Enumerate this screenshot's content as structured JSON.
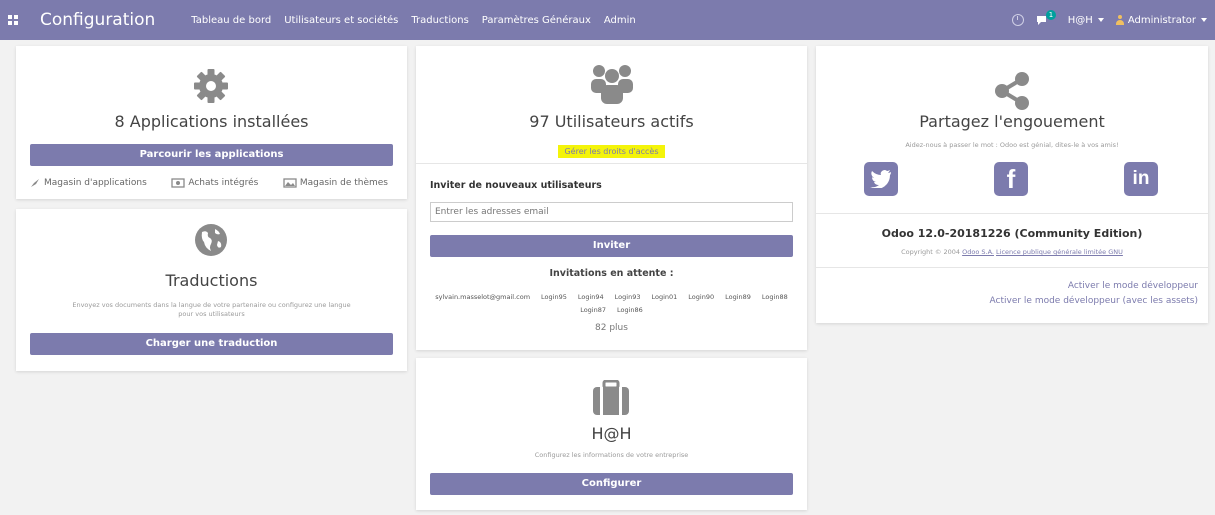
{
  "navbar": {
    "title": "Configuration",
    "menu": [
      "Tableau de bord",
      "Utilisateurs et sociétés",
      "Traductions",
      "Paramètres Généraux",
      "Admin"
    ],
    "chat_count": "1",
    "company": "H@H",
    "user": "Administrator"
  },
  "apps_card": {
    "heading": "8 Applications installées",
    "button": "Parcourir les applications",
    "links": [
      "Magasin d'applications",
      "Achats intégrés",
      "Magasin de thèmes"
    ]
  },
  "translations_card": {
    "heading": "Traductions",
    "description": "Envoyez vos documents dans la langue de votre partenaire ou configurez une langue pour vos utilisateurs",
    "button": "Charger une traduction"
  },
  "users_card": {
    "heading": "97 Utilisateurs actifs",
    "access_link": "Gérer les droits d'accès",
    "invite_label": "Inviter de nouveaux utilisateurs",
    "email_placeholder": "Entrer les adresses email",
    "invite_button": "Inviter",
    "pending_title": "Invitations en attente :",
    "pending": [
      "sylvain.masselot@gmail.com",
      "Login95",
      "Login94",
      "Login93",
      "Login01",
      "Login90",
      "Login89",
      "Login88",
      "Login87",
      "Login86"
    ],
    "more": "82 plus"
  },
  "company_card": {
    "heading": "H@H",
    "description": "Configurez les informations de votre entreprise",
    "button": "Configurer"
  },
  "share_card": {
    "heading": "Partagez l'engouement",
    "subtitle": "Aidez-nous à passer le mot : Odoo est génial, dites-le à vos amis!",
    "social": [
      "twitter",
      "facebook",
      "linkedin"
    ],
    "version": "Odoo 12.0-20181226 (Community Edition)",
    "copyright": "Copyright © 2004",
    "odoo_link": "Odoo S.A.",
    "license_link": "Licence publique générale limitée GNU",
    "dev_mode": "Activer le mode développeur",
    "dev_mode_assets": "Activer le mode développeur (avec les assets)"
  }
}
